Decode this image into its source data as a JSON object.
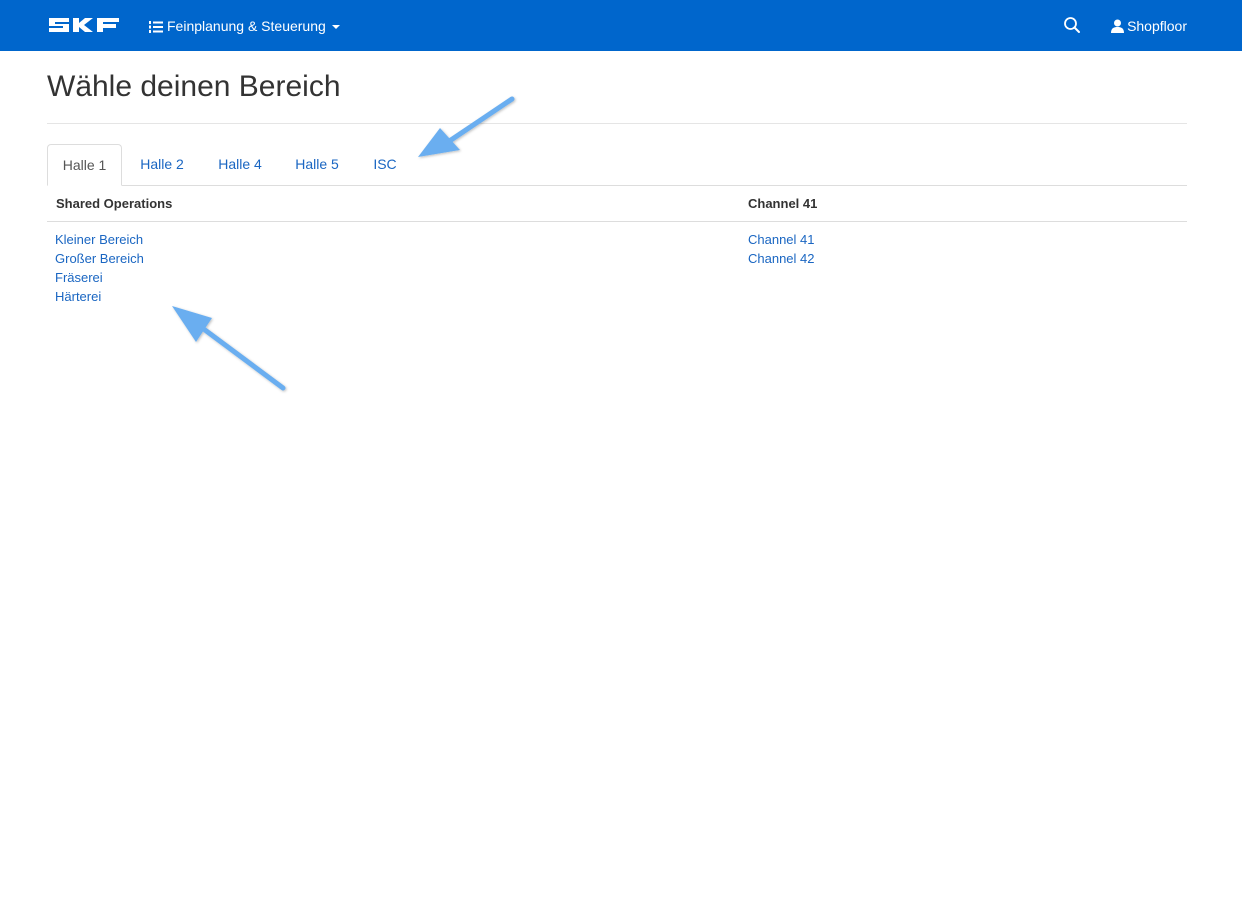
{
  "navbar": {
    "brand": "SKF",
    "app_menu_label": "Feinplanung & Steuerung",
    "user_label": "Shopfloor",
    "colors": {
      "background": "#0066cc",
      "text": "#ffffff"
    }
  },
  "page": {
    "title": "Wähle deinen Bereich"
  },
  "tabs": [
    {
      "label": "Halle 1",
      "active": true
    },
    {
      "label": "Halle 2",
      "active": false
    },
    {
      "label": "Halle 4",
      "active": false
    },
    {
      "label": "Halle 5",
      "active": false
    },
    {
      "label": "ISC",
      "active": false
    }
  ],
  "columns": [
    {
      "header": "Shared Operations",
      "links": [
        "Kleiner Bereich",
        "Großer Bereich",
        "Fräserei",
        "Härterei"
      ]
    },
    {
      "header": "Channel 41",
      "links": [
        "Channel 41",
        "Channel 42"
      ]
    }
  ],
  "colors": {
    "link": "#1a66c2",
    "annotation_arrow": "#6aaef0"
  }
}
